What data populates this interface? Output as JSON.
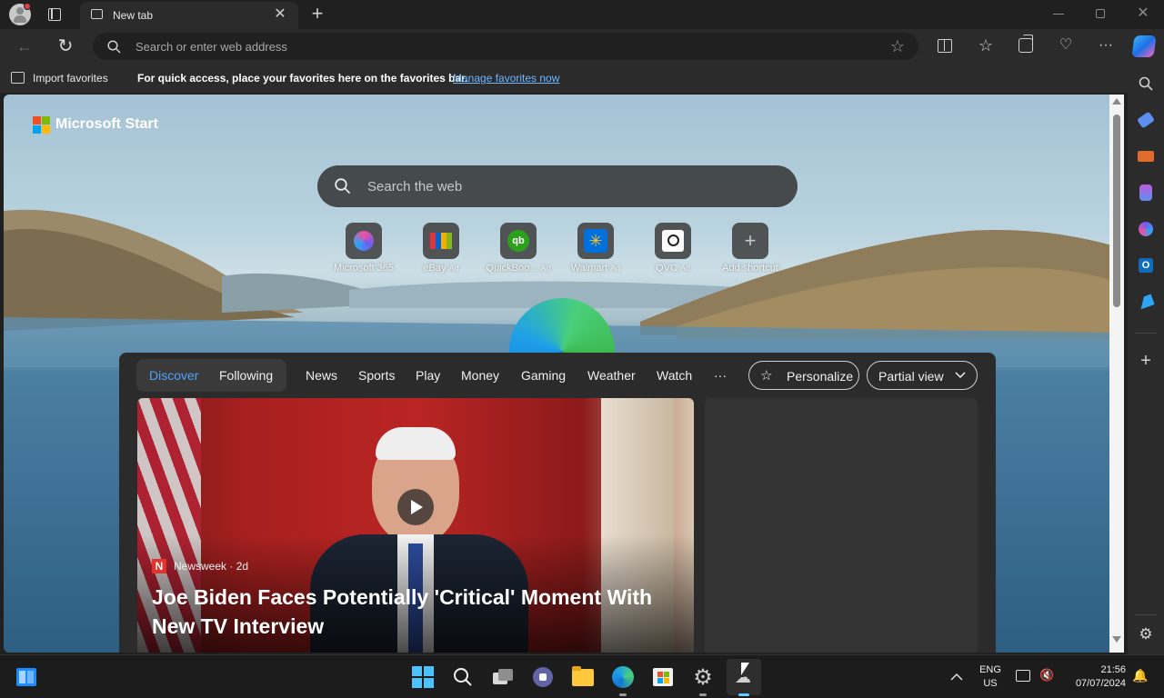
{
  "tab": {
    "title": "New tab"
  },
  "address": {
    "placeholder": "Search or enter web address"
  },
  "favorites": {
    "import_label": "Import favorites",
    "message": "For quick access, place your favorites here on the favorites bar.",
    "manage_link": "Manage favorites now"
  },
  "brand": {
    "name": "Microsoft Start"
  },
  "search": {
    "placeholder": "Search the web"
  },
  "shortcuts": [
    {
      "label": "Microsoft 365",
      "ad": ""
    },
    {
      "label": "eBay",
      "ad": "Ad"
    },
    {
      "label": "QuickBoo...",
      "ad": "Ad"
    },
    {
      "label": "Walmart",
      "ad": "Ad"
    },
    {
      "label": "QVC",
      "ad": "Ad"
    },
    {
      "label": "Add shortcut",
      "ad": ""
    }
  ],
  "feed_nav": {
    "discover": "Discover",
    "following": "Following",
    "items": [
      "News",
      "Sports",
      "Play",
      "Money",
      "Gaming",
      "Weather",
      "Watch"
    ],
    "more": "···",
    "personalize": "Personalize",
    "view": "Partial view"
  },
  "story": {
    "source": "Newsweek",
    "age": "2d",
    "source_separator": "·",
    "source_badge": "N",
    "headline_line1": "Joe Biden Faces Potentially 'Critical' Moment With",
    "headline_line2": "New TV Interview"
  },
  "tray": {
    "lang": "ENG",
    "region": "US",
    "time": "21:56",
    "date": "07/07/2024"
  },
  "colors": {
    "accent_link": "#6cb8ff",
    "discover_blue": "#4fa3f7"
  }
}
